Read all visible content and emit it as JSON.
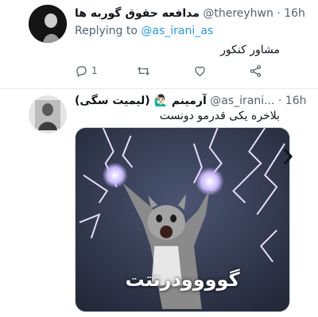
{
  "tweets": [
    {
      "display_name": "مدافعه حقوق گوربه ها",
      "handle": "@thereyhwn",
      "dot": "·",
      "time": "16h",
      "replying_prefix": "Replying to",
      "replying_to": "@as_irani_as",
      "text": "مشاور کنکور",
      "actions": {
        "reply_count": "1",
        "retweet_count": "",
        "like_count": "",
        "share_count": ""
      }
    },
    {
      "display_name": "آرمینم 🙋🏻‍♂️ (لیمیت سگی)",
      "handle": "@as_irani...",
      "dot": "·",
      "time": "16h",
      "text": "بلاخره یکی قدرمو دونست",
      "media": {
        "caption": "گوووودرتتت",
        "icon": "cat-lightning-image"
      }
    }
  ],
  "colors": {
    "accent": "#1d9bf0",
    "muted": "#536471",
    "text": "#0f1419",
    "border": "#e6ecf0"
  }
}
